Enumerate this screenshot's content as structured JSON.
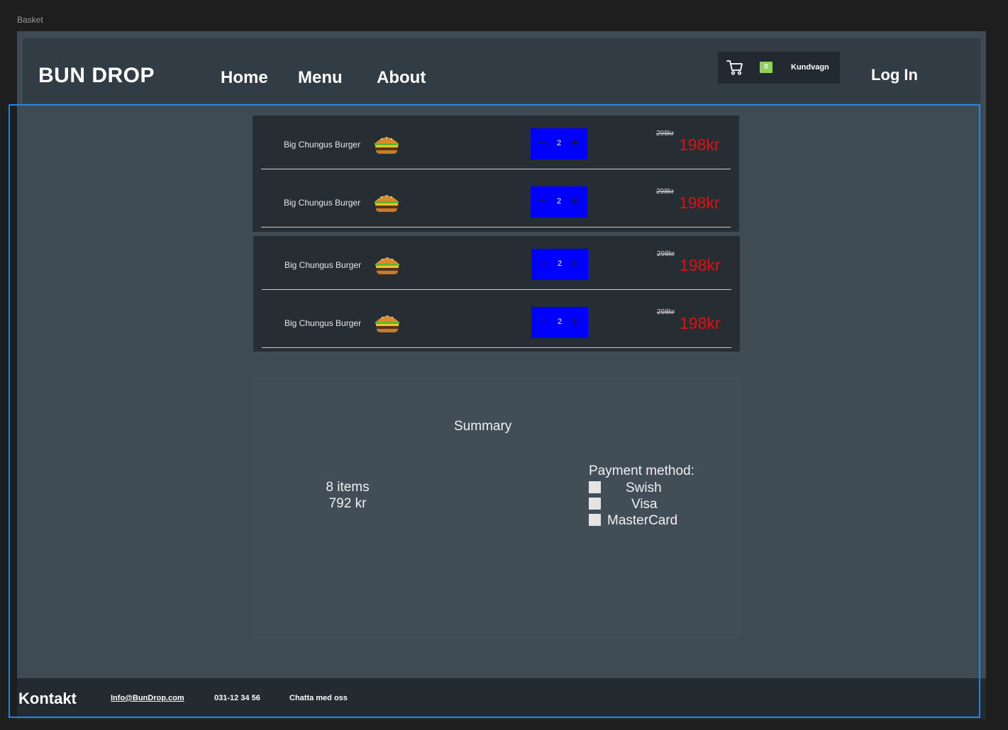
{
  "frame_label": "Basket",
  "header": {
    "logo": "BUN DROP",
    "nav": [
      "Home",
      "Menu",
      "About"
    ],
    "cart_count": "0",
    "cart_label": "Kundvagn",
    "login": "Log In"
  },
  "cart_items": [
    {
      "name": "Big Chungus Burger",
      "qty": "2",
      "old_price": "298kr",
      "price": "198kr"
    },
    {
      "name": "Big Chungus Burger",
      "qty": "2",
      "old_price": "298kr",
      "price": "198kr"
    },
    {
      "name": "Big Chungus Burger",
      "qty": "2",
      "old_price": "298kr",
      "price": "198kr"
    },
    {
      "name": "Big Chungus Burger",
      "qty": "2",
      "old_price": "298kr",
      "price": "198kr"
    }
  ],
  "qty_controls": {
    "minus": "−",
    "plus": "+"
  },
  "summary": {
    "title": "Summary",
    "items": "8 items",
    "total": "792 kr",
    "payment_title": "Payment method:",
    "payment_options": [
      "Swish",
      "Visa",
      "MasterCard"
    ]
  },
  "footer": {
    "title": "Kontakt",
    "email": "Info@BunDrop.com",
    "phone": "031-12 34 56",
    "chat": "Chatta med oss"
  },
  "colors": {
    "qty_bg": "#0000ff",
    "price": "#e01010",
    "cart_badge": "#8fd15c",
    "selection": "#1e88e5"
  }
}
